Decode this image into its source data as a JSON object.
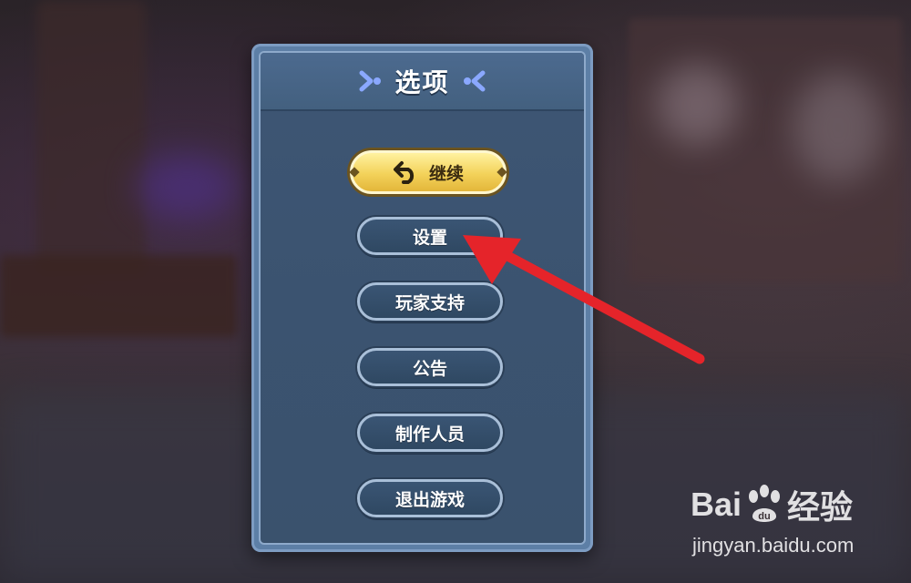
{
  "menu": {
    "title": "选项",
    "continue_label": "继续",
    "items": [
      {
        "label": "设置"
      },
      {
        "label": "玩家支持"
      },
      {
        "label": "公告"
      },
      {
        "label": "制作人员"
      },
      {
        "label": "退出游戏"
      }
    ]
  },
  "annotation": {
    "arrow_color": "#e5242a",
    "target": "设置"
  },
  "watermark": {
    "logo_text_left": "Bai",
    "logo_text_right": "经验",
    "url": "jingyan.baidu.com"
  },
  "colors": {
    "panel": "#3e5674",
    "continue_button": "#f3d25a",
    "menu_button": "#2f4862"
  }
}
